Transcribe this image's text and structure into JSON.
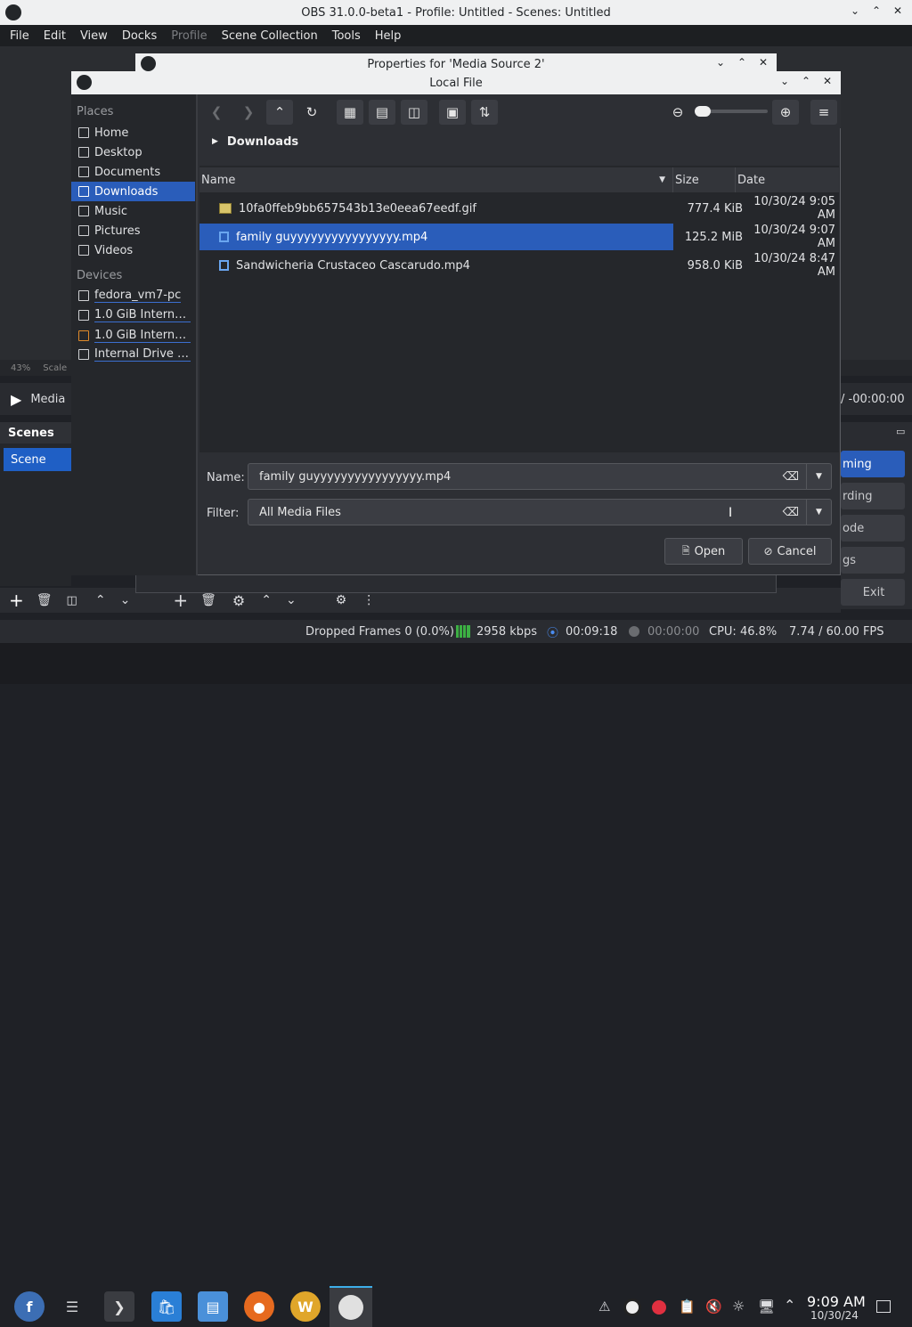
{
  "obs": {
    "title": "OBS 31.0.0-beta1 - Profile: Untitled - Scenes: Untitled",
    "menu": [
      "File",
      "Edit",
      "View",
      "Docks",
      "Profile",
      "Scene Collection",
      "Tools",
      "Help"
    ],
    "preview_status": {
      "zoom": "43%",
      "scale_label": "Scale"
    },
    "media_label": "Media",
    "media_time": "/ -00:00:00",
    "scenes_header": "Scenes",
    "scene_item": "Scene",
    "right_buttons": [
      "ming",
      "rding",
      "ode",
      "gs",
      "Exit"
    ],
    "status": {
      "dropped": "Dropped Frames 0 (0.0%)",
      "bitrate": "2958 kbps",
      "rec_time": "00:09:18",
      "stream_time": "00:00:00",
      "cpu": "CPU: 46.8%",
      "fps": "7.74 / 60.00 FPS"
    }
  },
  "props_title": "Properties for 'Media Source 2'",
  "dialog": {
    "title": "Local File",
    "places_header": "Places",
    "places": [
      {
        "label": "Home",
        "icon": "home-icon"
      },
      {
        "label": "Desktop",
        "icon": "desktop-icon"
      },
      {
        "label": "Documents",
        "icon": "documents-icon"
      },
      {
        "label": "Downloads",
        "icon": "downloads-icon",
        "selected": true
      },
      {
        "label": "Music",
        "icon": "music-icon"
      },
      {
        "label": "Pictures",
        "icon": "pictures-icon"
      },
      {
        "label": "Videos",
        "icon": "videos-icon"
      }
    ],
    "devices_header": "Devices",
    "devices": [
      {
        "label": "fedora_vm7-pc",
        "icon": "drive-icon"
      },
      {
        "label": "1.0 GiB Internal ...",
        "icon": "drive-icon"
      },
      {
        "label": "1.0 GiB Internal ...",
        "icon": "drive-icon"
      },
      {
        "label": "Internal Drive (s...",
        "icon": "drive-icon"
      }
    ],
    "breadcrumb": "Downloads",
    "columns": {
      "name": "Name",
      "size": "Size",
      "date": "Date"
    },
    "files": [
      {
        "name": "10fa0ffeb9bb657543b13e0eea67eedf.gif",
        "size": "777.4 KiB",
        "date": "10/30/24 9:05 AM",
        "icon": "image-file-icon"
      },
      {
        "name": "family guyyyyyyyyyyyyyyyy.mp4",
        "size": "125.2 MiB",
        "date": "10/30/24 9:07 AM",
        "icon": "video-file-icon",
        "selected": true
      },
      {
        "name": "Sandwicheria Crustaceo Cascarudo.mp4",
        "size": "958.0 KiB",
        "date": "10/30/24 8:47 AM",
        "icon": "video-file-icon"
      }
    ],
    "name_label": "Name:",
    "name_value": "family guyyyyyyyyyyyyyyyy.mp4",
    "filter_label": "Filter:",
    "filter_value": "All Media Files",
    "open_label": "Open",
    "cancel_label": "Cancel"
  },
  "taskbar": {
    "time": "9:09 AM",
    "date": "10/30/24"
  },
  "colors": {
    "accent": "#2a5dba",
    "bg": "#2d2f34",
    "titlebar": "#eff0f1"
  }
}
